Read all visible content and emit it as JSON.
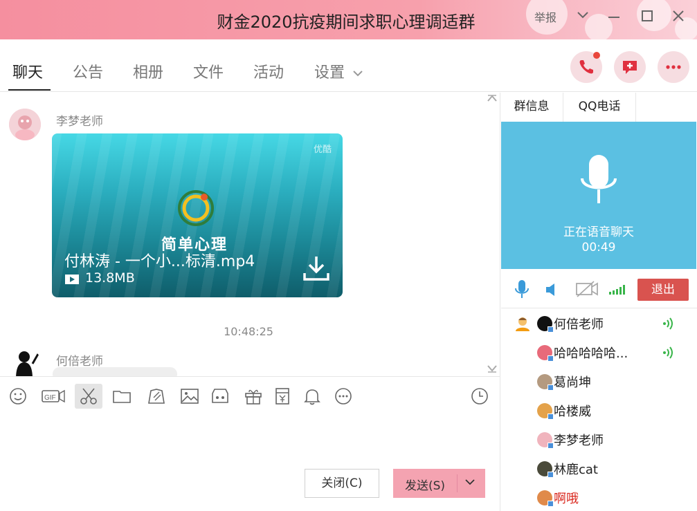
{
  "window": {
    "title": "财金2020抗疫期间求职心理调适群",
    "report_label": "举报",
    "accent": "#f58f9f"
  },
  "tabs": [
    {
      "label": "聊天",
      "active": true
    },
    {
      "label": "公告"
    },
    {
      "label": "相册"
    },
    {
      "label": "文件"
    },
    {
      "label": "活动"
    },
    {
      "label": "设置"
    }
  ],
  "header_actions": [
    "phone-call-icon",
    "message-plus-icon",
    "more-icon"
  ],
  "chat": {
    "messages": [
      {
        "sender": "李梦老师",
        "video": {
          "watermark": "优酷",
          "logo_text": "简单心理",
          "filename": "付林涛 - 一个小...标清.mp4",
          "size": "13.8MB"
        }
      },
      {
        "timestamp": "10:48:25"
      },
      {
        "sender": "何倍老师"
      }
    ]
  },
  "toolbar": {
    "tools": [
      "emoji-icon",
      "gif-icon",
      "scissors-icon",
      "folder-icon",
      "doodle-icon",
      "image-icon",
      "gallery-icon",
      "gift-icon",
      "red-packet-icon",
      "bell-icon",
      "more-icon"
    ],
    "history_icon": "clock-icon"
  },
  "buttons": {
    "close": "关闭(C)",
    "send": "发送(S)"
  },
  "right_panel": {
    "tabs": [
      "群信息",
      "QQ电话"
    ],
    "voice": {
      "status": "正在语音聊天",
      "time": "00:49",
      "panel_color": "#5bc0e2"
    },
    "exit_label": "退出",
    "members": [
      {
        "name": "何倍老师",
        "speaking": true
      },
      {
        "name": "哈哈哈哈哈...",
        "speaking": true
      },
      {
        "name": "葛尚坤"
      },
      {
        "name": "哈楼威"
      },
      {
        "name": "李梦老师"
      },
      {
        "name": "林鹿cat"
      },
      {
        "name": "啊哦",
        "highlight": true
      }
    ]
  }
}
